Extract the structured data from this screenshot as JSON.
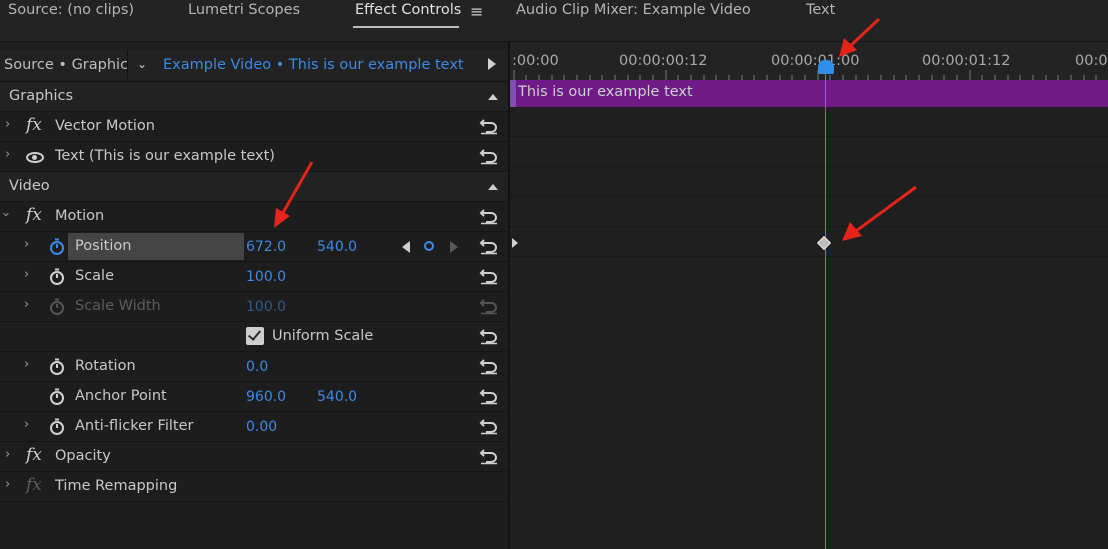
{
  "tabs": [
    {
      "label": "Source: (no clips)"
    },
    {
      "label": "Lumetri Scopes"
    },
    {
      "label": "Effect Controls"
    },
    {
      "label": "Audio Clip Mixer: Example Video"
    },
    {
      "label": "Text"
    }
  ],
  "active_tab": "Effect Controls",
  "header": {
    "source_label": "Source • Graphic",
    "clip_link": "Example Video • This is our example text"
  },
  "sections": {
    "graphics": "Graphics",
    "video": "Video"
  },
  "effects": {
    "vector_motion": "Vector Motion",
    "text_layer": "Text (This is our example text)",
    "motion": "Motion",
    "opacity": "Opacity",
    "time_remapping": "Time Remapping"
  },
  "properties": {
    "position": {
      "label": "Position",
      "x": "672.0",
      "y": "540.0"
    },
    "scale": {
      "label": "Scale",
      "value": "100.0"
    },
    "scale_width": {
      "label": "Scale Width",
      "value": "100.0"
    },
    "uniform_scale": {
      "label": "Uniform Scale",
      "checked": true
    },
    "rotation": {
      "label": "Rotation",
      "value": "0.0"
    },
    "anchor_point": {
      "label": "Anchor Point",
      "x": "960.0",
      "y": "540.0"
    },
    "anti_flicker": {
      "label": "Anti-flicker Filter",
      "value": "0.00"
    }
  },
  "timeline": {
    "timecodes": [
      ":00:00",
      "00:00:00:12",
      "00:00:01:00",
      "00:00:01:12",
      "00:0"
    ],
    "clip_label": "This is our example text"
  },
  "colors": {
    "accent_blue": "#3d8ae6",
    "clip_purple": "#6e1b87",
    "annotation_red": "#e3241b"
  }
}
